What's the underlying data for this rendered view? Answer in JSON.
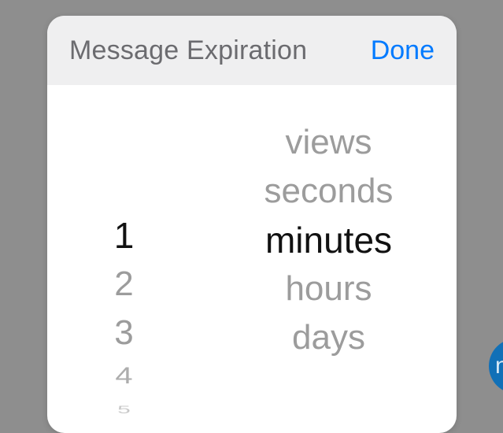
{
  "header": {
    "title": "Message Expiration",
    "done_label": "Done"
  },
  "picker": {
    "numbers": {
      "selected_index": 0,
      "items": [
        "1",
        "2",
        "3",
        "4",
        "5"
      ]
    },
    "units": {
      "selected_index": 2,
      "items": [
        "views",
        "seconds",
        "minutes",
        "hours",
        "days"
      ]
    }
  },
  "colors": {
    "accent": "#007aff",
    "fab": "#1170b7"
  },
  "fab": {
    "partial_text": "n"
  }
}
